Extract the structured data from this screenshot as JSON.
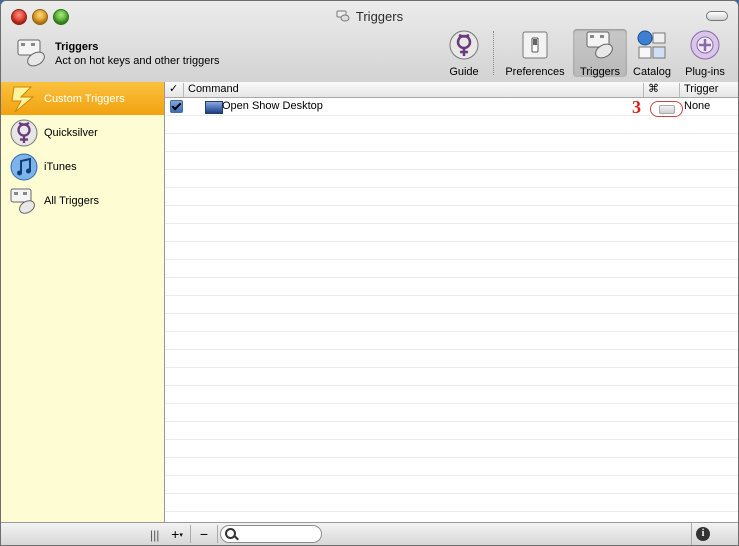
{
  "window": {
    "title": "Triggers"
  },
  "header": {
    "title": "Triggers",
    "subtitle": "Act on hot keys and other triggers"
  },
  "toolbar": {
    "items": [
      {
        "label": "Guide",
        "icon": "quicksilver-guide-icon"
      },
      {
        "label": "Preferences",
        "icon": "preferences-switch-icon"
      },
      {
        "label": "Triggers",
        "icon": "triggers-icon",
        "selected": true
      },
      {
        "label": "Catalog",
        "icon": "catalog-icon"
      },
      {
        "label": "Plug-ins",
        "icon": "plugins-icon"
      }
    ]
  },
  "sidebar": {
    "items": [
      {
        "label": "Custom Triggers",
        "icon": "lightning-icon",
        "selected": true
      },
      {
        "label": "Quicksilver",
        "icon": "quicksilver-icon"
      },
      {
        "label": "iTunes",
        "icon": "itunes-icon"
      },
      {
        "label": "All Triggers",
        "icon": "triggers-icon"
      }
    ]
  },
  "table": {
    "columns": {
      "enabled": "✓",
      "command": "Command",
      "key": "⌘",
      "trigger": "Trigger"
    },
    "rows": [
      {
        "enabled": true,
        "command": "Open Show Desktop",
        "trigger": "None"
      }
    ]
  },
  "annotation": {
    "label": "3",
    "color": "#d2201b"
  },
  "bottombar": {
    "add": "+",
    "add_menu": "▾",
    "remove": "−",
    "grip": "|||",
    "info": "i",
    "search_placeholder": ""
  },
  "colors": {
    "sidebar_bg": "#fdfcd2",
    "selected_orange": "#f1a210"
  }
}
